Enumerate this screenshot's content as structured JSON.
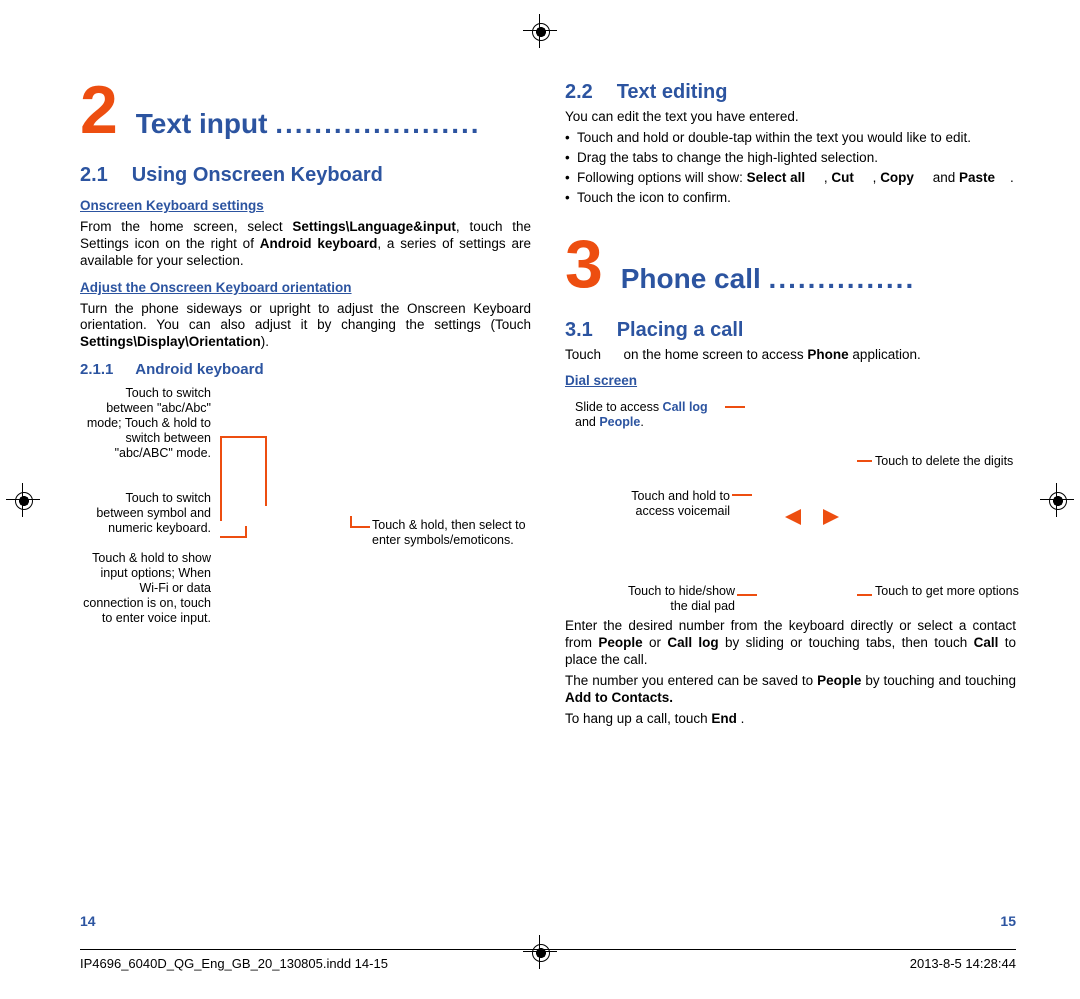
{
  "chapter2": {
    "num": "2",
    "title": "Text input",
    "dots": "....................."
  },
  "s21": {
    "num": "2.1",
    "title": "Using Onscreen Keyboard",
    "sub1": "Onscreen Keyboard settings",
    "p1_a": "From the home screen, select ",
    "p1_b": "Settings\\Language&input",
    "p1_c": ", touch the Settings icon ",
    "p1_d": " on the right of ",
    "p1_e": "Android keyboard",
    "p1_f": ", a series of settings are available for your selection.",
    "sub2": "Adjust the Onscreen Keyboard orientation",
    "p2_a": "Turn the phone sideways or upright to adjust the Onscreen Keyboard orientation. You can also adjust it by changing the settings (Touch ",
    "p2_b": "Settings\\Display\\Orientation",
    "p2_c": ")."
  },
  "s211": {
    "num": "2.1.1",
    "title": "Android keyboard",
    "noteA": "Touch to switch between \"abc/Abc\" mode; Touch & hold to switch between \"abc/ABC\" mode.",
    "noteB": "Touch to switch between symbol and numeric keyboard.",
    "noteC": "Touch & hold to show input options; When Wi-Fi or data connection is on, touch to enter voice input.",
    "noteD": "Touch & hold, then select to enter symbols/emoticons."
  },
  "s22": {
    "num": "2.2",
    "title": "Text editing",
    "intro": "You can edit the text you have entered.",
    "b1": "Touch and hold or double-tap within the text you would like to edit.",
    "b2": "Drag the tabs to change the high-lighted selection.",
    "b3_a": "Following options will show: ",
    "b3_sel": "Select all",
    "b3_sep1": ", ",
    "b3_cut": "Cut",
    "b3_sep2": ", ",
    "b3_copy": "Copy",
    "b3_sep3": " and ",
    "b3_paste": "Paste",
    "b3_end": ".",
    "b4": "Touch the icon      to confirm."
  },
  "chapter3": {
    "num": "3",
    "title": "Phone call",
    "dots": "..............."
  },
  "s31": {
    "num": "3.1",
    "title": "Placing a call",
    "p1_a": "Touch ",
    "p1_b": " on the home screen to access ",
    "p1_c": "Phone",
    "p1_d": " application.",
    "dial_hdr": "Dial screen",
    "noteA_a": "Slide to access ",
    "noteA_b": "Call log",
    "noteA_c": " and ",
    "noteA_d": "People",
    "noteA_e": ".",
    "noteB": "Touch and hold to access voicemail",
    "noteC": "Touch to delete the digits",
    "noteD": "Touch to hide/show the dial pad",
    "noteE": "Touch to get more options",
    "p2_a": "Enter the desired number from the keyboard directly or select a contact from ",
    "p2_b": "People",
    "p2_c": " or ",
    "p2_d": "Call log",
    "p2_e": " by sliding or touching tabs, then touch ",
    "p2_f": "Call",
    "p2_g": " to place the call.",
    "p3_a": "The number you entered can be saved to ",
    "p3_b": "People",
    "p3_c": " by touching   and touching ",
    "p3_d": "Add to Contacts.",
    "p4_a": "To hang up a call, touch ",
    "p4_b": "End",
    "p4_c": " ."
  },
  "page_left": "14",
  "page_right": "15",
  "footer_left": "IP4696_6040D_QG_Eng_GB_20_130805.indd   14-15",
  "footer_right": "2013-8-5   14:28:44"
}
